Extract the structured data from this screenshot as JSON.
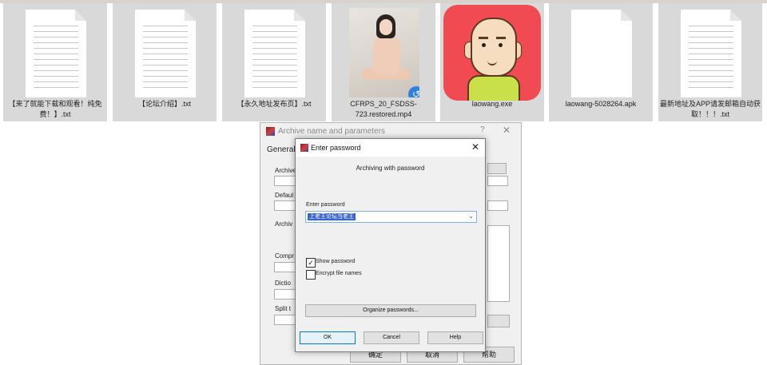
{
  "files": [
    {
      "name": "【来了就能下载和观看！纯免费！】.txt",
      "type": "txt"
    },
    {
      "name": "【论坛介绍】.txt",
      "type": "txt"
    },
    {
      "name": "【永久地址发布页】.txt",
      "type": "txt"
    },
    {
      "name": "CFRPS_20_FSDSS-723.restored.mp4",
      "type": "video"
    },
    {
      "name": "laowang.exe",
      "type": "exe"
    },
    {
      "name": "laowang-5028264.apk",
      "type": "apk"
    },
    {
      "name": "最新地址及APP请发邮箱自动获取！！！.txt",
      "type": "txt"
    }
  ],
  "archive_dialog": {
    "title": "Archive name and parameters",
    "help_glyph": "?",
    "close_glyph": "✕",
    "tab": "General",
    "buttons": [
      "确定",
      "取消",
      "帮助"
    ]
  },
  "password_dialog": {
    "title": "Enter password",
    "close_glyph": "✕",
    "heading": "Archiving with password",
    "password_label": "Enter password",
    "password_value": "上老王论坛当老王",
    "show_password": {
      "label": "Show password",
      "checked": true,
      "mark": "✓"
    },
    "encrypt_names": {
      "label": "Encrypt file names",
      "checked": false,
      "mark": ""
    },
    "organize_label": "Organize passwords...",
    "ok_label": "OK",
    "cancel_label": "Cancel",
    "help_label": "Help"
  },
  "colors": {
    "selection": "#3a66cf",
    "app_icon_bg": "#f24a52"
  }
}
